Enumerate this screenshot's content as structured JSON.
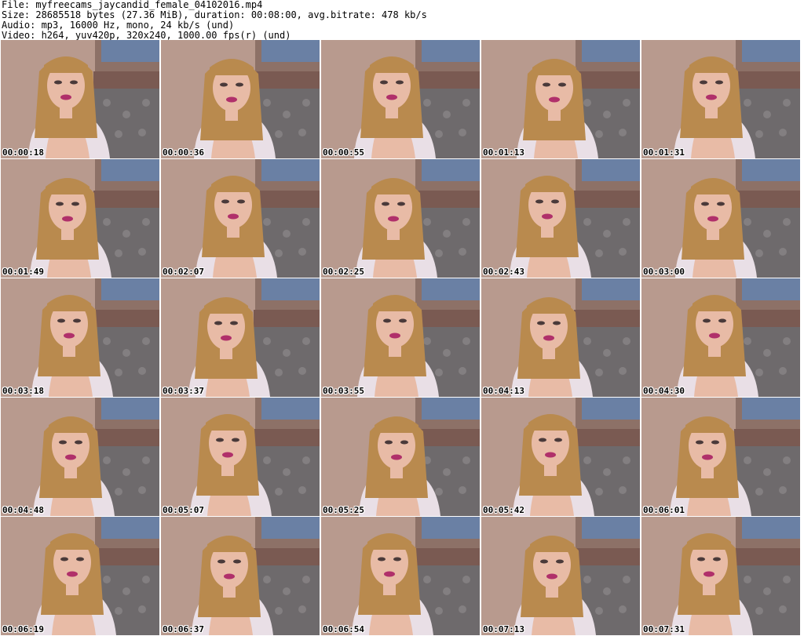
{
  "header": {
    "file_line": "File: myfreecams_jaycandid_female_04102016.mp4",
    "size_line": "Size: 28685518 bytes (27.36 MiB), duration: 00:08:00, avg.bitrate: 478 kb/s",
    "audio_line": "Audio: mp3, 16000 Hz, mono, 24 kb/s (und)",
    "video_line": "Video: h264, yuv420p, 320x240, 1000.00 fps(r) (und)"
  },
  "thumbnails": [
    {
      "timestamp": "00:00:18"
    },
    {
      "timestamp": "00:00:36"
    },
    {
      "timestamp": "00:00:55"
    },
    {
      "timestamp": "00:01:13"
    },
    {
      "timestamp": "00:01:31"
    },
    {
      "timestamp": "00:01:49"
    },
    {
      "timestamp": "00:02:07"
    },
    {
      "timestamp": "00:02:25"
    },
    {
      "timestamp": "00:02:43"
    },
    {
      "timestamp": "00:03:00"
    },
    {
      "timestamp": "00:03:18"
    },
    {
      "timestamp": "00:03:37"
    },
    {
      "timestamp": "00:03:55"
    },
    {
      "timestamp": "00:04:13"
    },
    {
      "timestamp": "00:04:30"
    },
    {
      "timestamp": "00:04:48"
    },
    {
      "timestamp": "00:05:07"
    },
    {
      "timestamp": "00:05:25"
    },
    {
      "timestamp": "00:05:42"
    },
    {
      "timestamp": "00:06:01"
    },
    {
      "timestamp": "00:06:19"
    },
    {
      "timestamp": "00:06:37"
    },
    {
      "timestamp": "00:06:54"
    },
    {
      "timestamp": "00:07:13"
    },
    {
      "timestamp": "00:07:31"
    }
  ],
  "colors": {
    "background": "#ffffff",
    "wall": "#b89a8e",
    "headboard": "#7a5a52",
    "bedspread": "#6e6a6c",
    "blouse": "#e9dfe6",
    "skin": "#e8bba6",
    "hair": "#b98a4e",
    "lips": "#b0306a"
  }
}
